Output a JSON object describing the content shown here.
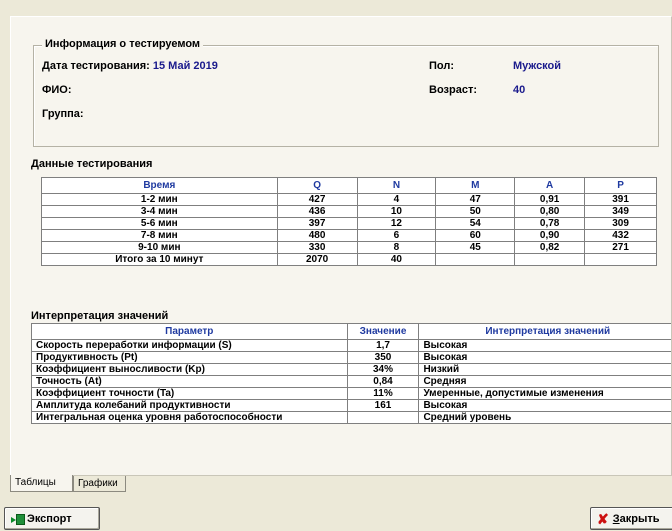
{
  "info": {
    "group_title": "Информация о тестируемом",
    "date_label": "Дата тестирования:",
    "date_value": "15 Май 2019",
    "fio_label": "ФИО:",
    "group_label": "Группа:",
    "sex_label": "Пол:",
    "sex_value": "Мужской",
    "age_label": "Возраст:",
    "age_value": "40"
  },
  "test_data": {
    "title": "Данные тестирования",
    "headers": [
      "Время",
      "Q",
      "N",
      "M",
      "A",
      "P"
    ],
    "rows": [
      [
        "1-2 мин",
        "427",
        "4",
        "47",
        "0,91",
        "391"
      ],
      [
        "3-4 мин",
        "436",
        "10",
        "50",
        "0,80",
        "349"
      ],
      [
        "5-6 мин",
        "397",
        "12",
        "54",
        "0,78",
        "309"
      ],
      [
        "7-8 мин",
        "480",
        "6",
        "60",
        "0,90",
        "432"
      ],
      [
        "9-10 мин",
        "330",
        "8",
        "45",
        "0,82",
        "271"
      ],
      [
        "Итого за 10 минут",
        "2070",
        "40",
        "",
        "",
        ""
      ]
    ]
  },
  "interp": {
    "title": "Интерпретация значений",
    "headers": [
      "Параметр",
      "Значение",
      "Интерпретация значений"
    ],
    "rows": [
      [
        "Скорость переработки информации (S)",
        "1,7",
        "Высокая"
      ],
      [
        "Продуктивность (Pt)",
        "350",
        "Высокая"
      ],
      [
        "Коэффициент выносливости (Kp)",
        "34%",
        "Низкий"
      ],
      [
        "Точность (At)",
        "0,84",
        "Средняя"
      ],
      [
        "Коэффициент точности (Ta)",
        "11%",
        "Умеренные, допустимые изменения"
      ],
      [
        "Амплитуда колебаний продуктивности",
        "161",
        "Высокая"
      ],
      [
        "Интегральная оценка уровня работоспособности",
        "",
        "Средний уровень"
      ]
    ]
  },
  "tabs": [
    "Таблицы",
    "Графики"
  ],
  "buttons": {
    "export": "Экспорт",
    "close_first": "З",
    "close_rest": "акрыть"
  },
  "colors": {
    "header_text": "#1f3aa0",
    "value_text": "#1a1a8c",
    "close_icon": "#cc1111",
    "export_icon": "#1f8f3a"
  },
  "icons": {
    "export": "export-icon",
    "close": "close-icon"
  }
}
